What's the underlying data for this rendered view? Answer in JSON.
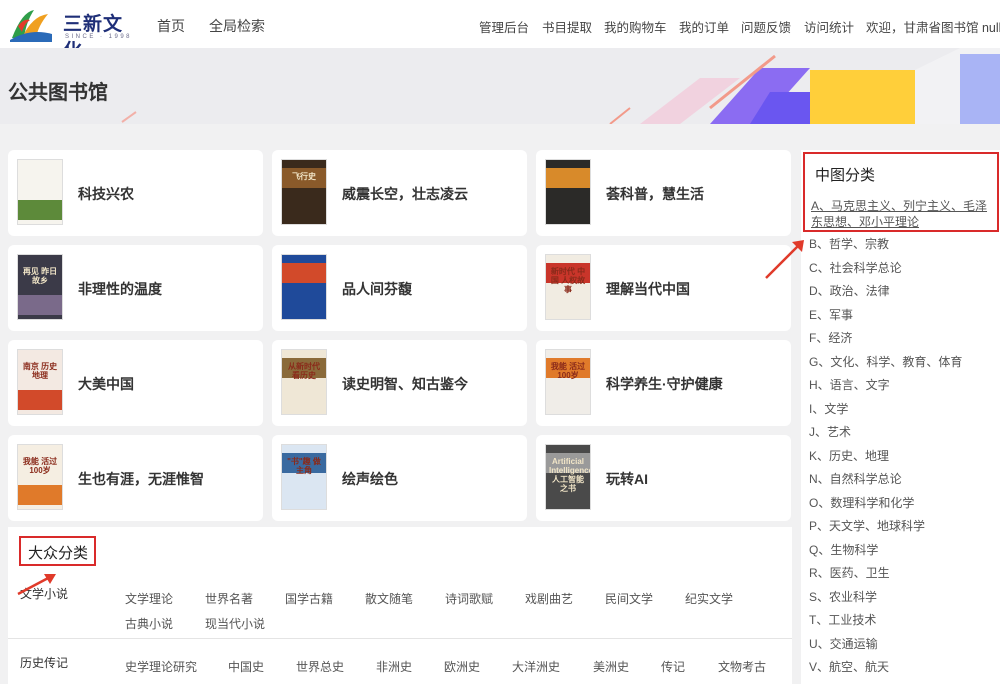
{
  "brand": {
    "name": "三新文化",
    "tagline": "SINCE · 1998"
  },
  "main_nav": [
    "首页",
    "全局检索"
  ],
  "user_nav": [
    "管理后台",
    "书目提取",
    "我的购物车",
    "我的订单",
    "问题反馈",
    "访问统计",
    "欢迎，甘肃省图书馆 null"
  ],
  "page": {
    "title": "公共图书馆"
  },
  "themes": [
    "科技兴农",
    "威震长空，壮志凌云",
    "荟科普，慧生活",
    "非理性的温度",
    "品人间芬馥",
    "理解当代中国",
    "大美中国",
    "读史明智、知古鉴今",
    "科学养生·守护健康",
    "生也有涯，无涯惟智",
    "绘声绘色",
    "玩转AI"
  ],
  "covers": [
    {
      "bg": "#f6f4ee",
      "band": "#5d8a3a",
      "text": ""
    },
    {
      "bg": "#3a2a1c",
      "band": "#8a5a2a",
      "text": "飞行史"
    },
    {
      "bg": "#2b2a28",
      "band": "#d88a2a",
      "text": ""
    },
    {
      "bg": "#3b3a48",
      "band": "#7a6a8a",
      "text": "再见 昨日故乡"
    },
    {
      "bg": "#1f4a9a",
      "band": "#d24a2a",
      "text": ""
    },
    {
      "bg": "#f1ece2",
      "band": "#c9352a",
      "text": "新时代 中国 人权故事"
    },
    {
      "bg": "#f3e9e2",
      "band": "#d24a2a",
      "text": "南京 历史地理"
    },
    {
      "bg": "#efe7d6",
      "band": "#8a6a3a",
      "text": "从新时代 看历史"
    },
    {
      "bg": "#f0ede8",
      "band": "#e07a2a",
      "text": "我能 活过100岁"
    },
    {
      "bg": "#f5eee2",
      "band": "#e07a2a",
      "text": "我能 活过100岁"
    },
    {
      "bg": "#dbe6f2",
      "band": "#3a6aa0",
      "text": "\"书\"趣 做主角"
    },
    {
      "bg": "#4a4a4a",
      "band": "#9a9a9a",
      "text": "Artificial Intelligence 人工智能之书"
    }
  ],
  "popular": {
    "title": "大众分类",
    "rows": [
      {
        "label": "文学小说",
        "links": [
          "文学理论",
          "世界名著",
          "国学古籍",
          "散文随笔",
          "诗词歌赋",
          "戏剧曲艺",
          "民间文学",
          "纪实文学",
          "古典小说",
          "现当代小说"
        ]
      },
      {
        "label": "历史传记",
        "links": [
          "史学理论研究",
          "中国史",
          "世界总史",
          "非洲史",
          "欧洲史",
          "大洋洲史",
          "美洲史",
          "传记",
          "文物考古"
        ]
      }
    ]
  },
  "clc": {
    "title": "中图分类",
    "items": [
      "A、马克思主义、列宁主义、毛泽东思想、邓小平理论",
      "B、哲学、宗教",
      "C、社会科学总论",
      "D、政治、法律",
      "E、军事",
      "F、经济",
      "G、文化、科学、教育、体育",
      "H、语言、文字",
      "I、文学",
      "J、艺术",
      "K、历史、地理",
      "N、自然科学总论",
      "O、数理科学和化学",
      "P、天文学、地球科学",
      "Q、生物科学",
      "R、医药、卫生",
      "S、农业科学",
      "T、工业技术",
      "U、交通运输",
      "V、航空、航天"
    ]
  },
  "colors": {
    "highlight_border": "#d92a2a",
    "arrow": "#e03a2a"
  }
}
